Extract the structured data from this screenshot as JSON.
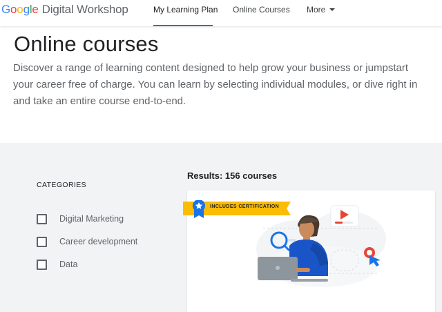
{
  "header": {
    "logo_brand": [
      "G",
      "o",
      "o",
      "g",
      "l",
      "e"
    ],
    "logo_product": "Digital Workshop",
    "nav": {
      "learning_plan": "My Learning Plan",
      "online_courses": "Online Courses",
      "more": "More"
    }
  },
  "hero": {
    "title": "Online courses",
    "description": "Discover a range of learning content designed to help grow your business or jumpstart your career free of charge. You can learn by selecting individual modules, or dive right in and take an entire course end-to-end."
  },
  "filters": {
    "heading": "CATEGORIES",
    "items": [
      {
        "label": "Digital Marketing",
        "checked": false
      },
      {
        "label": "Career development",
        "checked": false
      },
      {
        "label": "Data",
        "checked": false
      }
    ]
  },
  "results": {
    "label": "Results: 156 courses"
  },
  "course_card": {
    "badge": "INCLUDES CERTIFICATION",
    "badge_icon": "star-ribbon-icon",
    "illustration": "person-with-laptop-illustration"
  },
  "colors": {
    "accent": "#1a73e8",
    "badge_yellow": "#fbbc04",
    "ribbon_blue": "#1a73e8",
    "band_bg": "#f1f3f4",
    "play_red": "#ea4335"
  }
}
